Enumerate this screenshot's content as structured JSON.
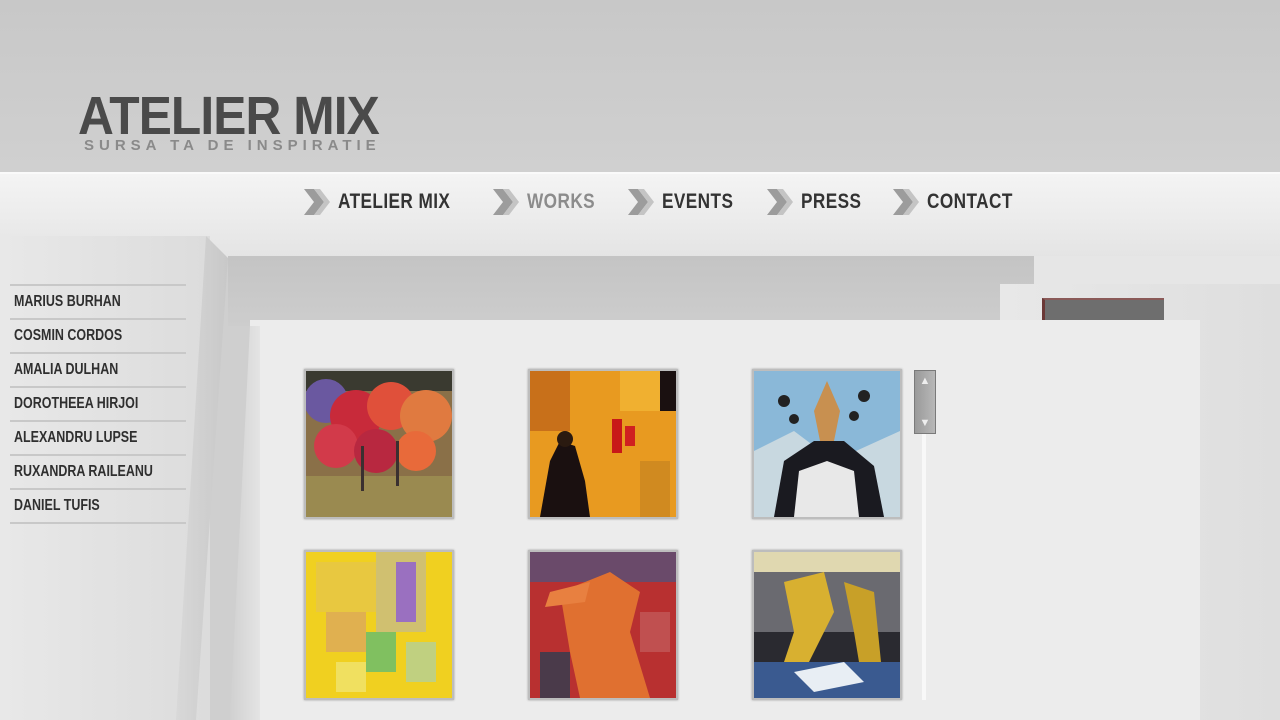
{
  "logo": {
    "title": "ATELIER MIX",
    "tagline": "SURSA TA DE INSPIRATIE"
  },
  "nav": {
    "items": [
      {
        "label": "ATELIER MIX",
        "active": false
      },
      {
        "label": "WORKS",
        "active": true
      },
      {
        "label": "EVENTS",
        "active": false
      },
      {
        "label": "PRESS",
        "active": false
      },
      {
        "label": "CONTACT",
        "active": false
      }
    ]
  },
  "artists": [
    "MARIUS BURHAN",
    "COSMIN CORDOS",
    "AMALIA DULHAN",
    "DOROTHEEA HIRJOI",
    "ALEXANDRU LUPSE",
    "RUXANDRA RAILEANU",
    "DANIEL TUFIS"
  ],
  "gallery": {
    "thumbnails": [
      {
        "name": "painting-red-trees"
      },
      {
        "name": "painting-orange-figure"
      },
      {
        "name": "painting-deer-portrait"
      },
      {
        "name": "painting-yellow-abstract"
      },
      {
        "name": "painting-orange-figure-red"
      },
      {
        "name": "painting-legs"
      }
    ]
  },
  "colors": {
    "header": "#c8c8c8",
    "navbar": "#ececec",
    "nav_text": "#333333",
    "nav_active": "#8c8c8c",
    "content": "#ececec"
  }
}
